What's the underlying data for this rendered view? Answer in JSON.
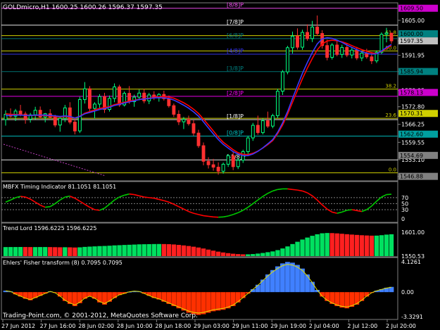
{
  "chart_data": [
    {
      "type": "candlestick",
      "title": "GOLDmicro,H1  1600.25 1600.26 1596.37 1597.35",
      "y_ticks": [
        "1605.00",
        "1597.35",
        "1591.95",
        "1585.90",
        "1578.85",
        "1572.80",
        "1566.25",
        "1559.55",
        "1553.10",
        "1546.85"
      ],
      "fib_levels": [
        {
          "label": "61.8",
          "value": 1599.3
        },
        {
          "label": "50.0",
          "value": 1593.6
        },
        {
          "label": "38.2",
          "value": 1579.4
        },
        {
          "label": "23.6",
          "value": 1568.5
        },
        {
          "label": "0.0",
          "value": 1548.2
        }
      ],
      "murrey_levels": [
        {
          "label": "[8/8]P",
          "value": 1609.5,
          "color": "#ff55ff"
        },
        {
          "label": "[7/8]P",
          "value": 1603.2,
          "color": "#ffffff"
        },
        {
          "label": "[6/8]P",
          "value": 1598.2,
          "color": "#008080"
        },
        {
          "label": "[4/8]P",
          "value": 1592.4,
          "color": "#3a3aff"
        },
        {
          "label": "[3/8]P",
          "value": 1585.9,
          "color": "#008080"
        },
        {
          "label": "[2/8]P",
          "value": 1576.7,
          "color": "#ff00ff"
        },
        {
          "label": "[1/8]P",
          "value": 1568.0,
          "color": "#ffffff"
        },
        {
          "label": "[0/8]P",
          "value": 1561.9,
          "color": "#00cccc"
        },
        {
          "label": "[-1/8]P",
          "value": 1553.0,
          "color": "#ffffff"
        }
      ],
      "price_tags": [
        {
          "label": "1609.50",
          "value": 1609.5,
          "color": "#cc00cc"
        },
        {
          "label": "1600.00",
          "value": 1600.0,
          "color": "#008080"
        },
        {
          "label": "1597.35",
          "value": 1597.35,
          "color": "#c0c0c0"
        },
        {
          "label": "1585.94",
          "value": 1585.94,
          "color": "#008080"
        },
        {
          "label": "1578.13",
          "value": 1578.13,
          "color": "#cc00cc"
        },
        {
          "label": "1570.31",
          "value": 1570.31,
          "color": "#d0d000"
        },
        {
          "label": "1562.60",
          "value": 1562.6,
          "color": "#00a0a0"
        },
        {
          "label": "1554.69",
          "value": 1554.69,
          "color": "#808080"
        },
        {
          "label": "1546.88",
          "value": 1546.88,
          "color": "#808080"
        }
      ],
      "ylim": [
        1546,
        1611
      ],
      "candles": [
        [
          1568.0,
          1571.5,
          1565.8,
          1570.0
        ],
        [
          1570.0,
          1572.2,
          1568.8,
          1569.3
        ],
        [
          1569.3,
          1572.0,
          1567.5,
          1571.2
        ],
        [
          1571.2,
          1573.5,
          1569.2,
          1570.1
        ],
        [
          1570.1,
          1571.0,
          1566.5,
          1568.2
        ],
        [
          1568.2,
          1570.5,
          1566.9,
          1569.8
        ],
        [
          1569.8,
          1572.8,
          1568.1,
          1571.5
        ],
        [
          1571.5,
          1572.9,
          1568.4,
          1569.0
        ],
        [
          1569.0,
          1570.5,
          1567.0,
          1570.2
        ],
        [
          1570.2,
          1571.9,
          1568.5,
          1568.9
        ],
        [
          1568.9,
          1569.8,
          1565.2,
          1566.0
        ],
        [
          1566.0,
          1569.4,
          1563.5,
          1568.5
        ],
        [
          1568.5,
          1573.5,
          1567.1,
          1572.4
        ],
        [
          1572.4,
          1574.5,
          1566.3,
          1567.1
        ],
        [
          1567.1,
          1568.5,
          1562.5,
          1563.8
        ],
        [
          1563.8,
          1576.5,
          1563.0,
          1575.5
        ],
        [
          1575.5,
          1582.0,
          1574.0,
          1579.5
        ],
        [
          1579.5,
          1580.5,
          1571.0,
          1572.2
        ],
        [
          1572.2,
          1574.5,
          1568.4,
          1573.8
        ],
        [
          1573.8,
          1577.5,
          1572.0,
          1576.6
        ],
        [
          1576.6,
          1578.0,
          1570.5,
          1571.8
        ],
        [
          1571.8,
          1577.0,
          1571.0,
          1575.9
        ],
        [
          1575.9,
          1581.5,
          1574.5,
          1580.2
        ],
        [
          1580.2,
          1581.0,
          1572.8,
          1573.5
        ],
        [
          1573.5,
          1578.5,
          1572.9,
          1577.8
        ],
        [
          1577.8,
          1580.5,
          1573.9,
          1574.7
        ],
        [
          1574.7,
          1577.3,
          1572.8,
          1576.4
        ],
        [
          1576.4,
          1579.2,
          1575.2,
          1577.9
        ],
        [
          1577.9,
          1579.5,
          1574.1,
          1575.0
        ],
        [
          1575.0,
          1578.0,
          1573.8,
          1577.2
        ],
        [
          1577.2,
          1578.6,
          1575.3,
          1576.1
        ],
        [
          1576.1,
          1577.9,
          1574.7,
          1577.4
        ],
        [
          1577.4,
          1578.8,
          1575.1,
          1575.8
        ],
        [
          1575.8,
          1577.0,
          1572.5,
          1573.2
        ],
        [
          1573.2,
          1574.0,
          1569.0,
          1570.0
        ],
        [
          1570.0,
          1571.5,
          1566.0,
          1567.2
        ],
        [
          1567.2,
          1569.0,
          1564.5,
          1568.1
        ],
        [
          1568.1,
          1569.5,
          1565.8,
          1566.5
        ],
        [
          1566.5,
          1567.8,
          1562.0,
          1563.0
        ],
        [
          1563.0,
          1564.2,
          1557.5,
          1558.3
        ],
        [
          1558.3,
          1559.5,
          1551.0,
          1552.5
        ],
        [
          1552.5,
          1554.0,
          1549.8,
          1551.2
        ],
        [
          1551.2,
          1553.4,
          1549.0,
          1550.3
        ],
        [
          1550.3,
          1552.1,
          1547.5,
          1548.8
        ],
        [
          1548.8,
          1552.0,
          1547.9,
          1551.4
        ],
        [
          1551.4,
          1555.2,
          1550.4,
          1554.6
        ],
        [
          1554.6,
          1556.0,
          1549.2,
          1550.5
        ],
        [
          1550.5,
          1553.8,
          1549.6,
          1552.9
        ],
        [
          1552.9,
          1556.8,
          1551.9,
          1556.1
        ],
        [
          1556.1,
          1562.0,
          1555.0,
          1561.2
        ],
        [
          1561.2,
          1566.8,
          1560.1,
          1565.9
        ],
        [
          1565.9,
          1569.5,
          1562.4,
          1563.2
        ],
        [
          1563.2,
          1568.4,
          1562.5,
          1567.6
        ],
        [
          1567.6,
          1571.0,
          1564.9,
          1565.6
        ],
        [
          1565.6,
          1570.2,
          1564.8,
          1569.5
        ],
        [
          1569.5,
          1579.5,
          1568.6,
          1578.6
        ],
        [
          1578.6,
          1586.5,
          1577.2,
          1585.8
        ],
        [
          1585.8,
          1595.5,
          1584.9,
          1594.8
        ],
        [
          1594.8,
          1600.8,
          1592.6,
          1599.1
        ],
        [
          1599.1,
          1602.0,
          1594.1,
          1595.0
        ],
        [
          1595.0,
          1601.5,
          1594.0,
          1600.5
        ],
        [
          1600.5,
          1603.5,
          1597.4,
          1598.2
        ],
        [
          1598.2,
          1604.8,
          1596.9,
          1602.5
        ],
        [
          1602.5,
          1606.8,
          1599.2,
          1600.1
        ],
        [
          1600.1,
          1601.3,
          1594.5,
          1595.6
        ],
        [
          1595.6,
          1597.8,
          1590.1,
          1591.2
        ],
        [
          1591.2,
          1596.5,
          1590.4,
          1595.8
        ],
        [
          1595.8,
          1597.2,
          1591.6,
          1592.3
        ],
        [
          1592.3,
          1595.9,
          1591.0,
          1594.9
        ],
        [
          1594.9,
          1596.3,
          1591.3,
          1592.1
        ],
        [
          1592.1,
          1594.8,
          1590.8,
          1593.9
        ],
        [
          1593.9,
          1595.1,
          1590.2,
          1591.0
        ],
        [
          1591.0,
          1593.6,
          1589.8,
          1592.8
        ],
        [
          1592.8,
          1594.4,
          1590.7,
          1591.4
        ],
        [
          1591.4,
          1593.2,
          1588.7,
          1589.9
        ],
        [
          1589.9,
          1593.8,
          1589.1,
          1593.1
        ],
        [
          1593.1,
          1600.5,
          1592.4,
          1599.8
        ],
        [
          1599.8,
          1602.2,
          1596.8,
          1600.25
        ],
        [
          1600.25,
          1600.26,
          1596.37,
          1597.35
        ]
      ],
      "ma_red": [
        1570.2,
        1570.0,
        1569.9,
        1569.8,
        1569.7,
        1569.6,
        1569.6,
        1569.6,
        1569.5,
        1569.4,
        1569.2,
        1569.0,
        1569.2,
        1569.0,
        1568.6,
        1569.3,
        1570.4,
        1571.0,
        1571.6,
        1572.2,
        1572.5,
        1572.9,
        1573.6,
        1574.0,
        1574.5,
        1574.9,
        1575.2,
        1575.6,
        1575.8,
        1576.0,
        1576.3,
        1576.5,
        1576.5,
        1576.4,
        1576.0,
        1575.2,
        1574.3,
        1573.2,
        1571.9,
        1570.3,
        1568.2,
        1566.0,
        1563.8,
        1561.5,
        1559.6,
        1558.2,
        1556.8,
        1555.7,
        1555.1,
        1555.0,
        1555.5,
        1556.3,
        1557.4,
        1558.7,
        1560.2,
        1562.8,
        1566.0,
        1570.0,
        1574.5,
        1578.9,
        1583.2,
        1587.2,
        1590.8,
        1594.0,
        1596.2,
        1597.3,
        1597.6,
        1597.4,
        1597.0,
        1596.4,
        1595.6,
        1594.8,
        1594.1,
        1593.5,
        1592.9,
        1592.6,
        1593.4,
        1594.6,
        1595.6
      ],
      "ma_blue": [
        1569.5,
        1569.6,
        1569.7,
        1569.7,
        1569.6,
        1569.6,
        1569.7,
        1569.7,
        1569.7,
        1569.6,
        1569.4,
        1569.2,
        1569.4,
        1569.2,
        1568.6,
        1569.2,
        1570.2,
        1570.7,
        1571.2,
        1571.8,
        1572.1,
        1572.6,
        1573.3,
        1573.7,
        1574.2,
        1574.6,
        1575.0,
        1575.5,
        1575.7,
        1575.9,
        1576.1,
        1576.2,
        1576.1,
        1575.9,
        1575.3,
        1574.4,
        1573.4,
        1572.3,
        1570.9,
        1569.3,
        1567.2,
        1564.9,
        1562.7,
        1560.6,
        1558.8,
        1557.4,
        1556.1,
        1555.2,
        1554.6,
        1554.6,
        1555.2,
        1556.2,
        1557.5,
        1559.0,
        1560.6,
        1563.3,
        1566.8,
        1571.0,
        1575.9,
        1580.6,
        1585.2,
        1589.3,
        1593.0,
        1596.2,
        1598.1,
        1598.5,
        1598.3,
        1597.6,
        1596.8,
        1595.8,
        1594.9,
        1594.1,
        1593.3,
        1592.8,
        1592.4,
        1592.5,
        1593.6,
        1594.9,
        1596.0
      ]
    },
    {
      "type": "line",
      "title": "MBFX Timing Indicator 81.1051 81.1051",
      "y_ticks": [
        "70",
        "50",
        "30",
        "0"
      ],
      "ylim": [
        -5,
        100
      ],
      "values": [
        55,
        62,
        70,
        74,
        72,
        65,
        55,
        45,
        38,
        40,
        50,
        62,
        72,
        75,
        68,
        58,
        48,
        38,
        30,
        28,
        35,
        48,
        62,
        72,
        78,
        82,
        80,
        76,
        72,
        70,
        68,
        64,
        60,
        55,
        48,
        40,
        32,
        24,
        18,
        14,
        10,
        8,
        6,
        5,
        6,
        9,
        14,
        20,
        28,
        38,
        50,
        62,
        74,
        84,
        92,
        97,
        99,
        99,
        97,
        95,
        92,
        86,
        76,
        62,
        46,
        32,
        22,
        18,
        22,
        28,
        30,
        27,
        24,
        30,
        42,
        58,
        72,
        80,
        81.1051
      ]
    },
    {
      "type": "bar",
      "title": "Trend Lord 1596.6225 1596.6225",
      "y_ticks": [
        "1601.00",
        "1550.53"
      ],
      "ylim": [
        1550.53,
        1601.0
      ],
      "values": [
        1569.6,
        1569.7,
        1569.7,
        1569.8,
        1569.7,
        1569.6,
        1569.6,
        1569.7,
        1569.7,
        1569.6,
        1569.4,
        1569.2,
        1569.3,
        1569.1,
        1568.7,
        1569.1,
        1570.0,
        1570.6,
        1571.1,
        1571.7,
        1572.0,
        1572.5,
        1573.2,
        1573.6,
        1574.1,
        1574.5,
        1574.9,
        1575.4,
        1575.6,
        1575.8,
        1576.0,
        1576.1,
        1576.0,
        1575.7,
        1575.1,
        1574.2,
        1573.1,
        1571.9,
        1570.4,
        1568.7,
        1566.6,
        1564.3,
        1562.1,
        1560.0,
        1558.2,
        1556.8,
        1555.6,
        1554.8,
        1554.3,
        1554.3,
        1554.9,
        1555.9,
        1557.2,
        1558.8,
        1560.5,
        1563.2,
        1566.7,
        1571.0,
        1576.0,
        1580.8,
        1585.5,
        1589.7,
        1593.4,
        1596.6,
        1598.7,
        1599.3,
        1599.1,
        1598.5,
        1597.7,
        1596.8,
        1596.0,
        1595.3,
        1594.6,
        1594.1,
        1593.7,
        1593.8,
        1594.7,
        1595.9,
        1596.6225
      ],
      "colors": "green=rising, red=falling"
    },
    {
      "type": "bar",
      "title": "Ehlers' Fisher transform (8) 0.7095 0.7095",
      "y_ticks": [
        "4.1261",
        "0.00",
        "-3.3291"
      ],
      "ylim": [
        -3.3291,
        4.1261
      ],
      "values": [
        0.2,
        0.1,
        -0.3,
        -0.6,
        -0.9,
        -1.1,
        -0.8,
        -0.5,
        -0.2,
        0.1,
        -0.1,
        -0.6,
        -1.2,
        -1.6,
        -1.9,
        -1.5,
        -0.9,
        -0.6,
        -0.9,
        -1.4,
        -1.7,
        -1.3,
        -0.8,
        -0.4,
        -0.2,
        0.05,
        0.15,
        0.1,
        -0.2,
        -0.5,
        -0.8,
        -1.0,
        -1.3,
        -1.6,
        -1.9,
        -2.2,
        -2.5,
        -2.8,
        -3.0,
        -3.1,
        -3.0,
        -2.8,
        -2.6,
        -2.5,
        -2.4,
        -2.2,
        -1.9,
        -1.4,
        -0.8,
        -0.2,
        0.4,
        1.0,
        1.7,
        2.4,
        3.0,
        3.5,
        3.9,
        4.1,
        4.0,
        3.7,
        3.2,
        2.4,
        1.4,
        0.3,
        -0.6,
        -1.2,
        -1.6,
        -1.9,
        -2.1,
        -2.2,
        -2.0,
        -1.7,
        -1.2,
        -0.6,
        -0.1,
        0.2,
        0.4,
        0.6,
        0.7095
      ]
    }
  ],
  "x_ticks": [
    "27 Jun 2012",
    "27 Jun 16:00",
    "28 Jun 02:00",
    "28 Jun 10:00",
    "28 Jun 18:00",
    "29 Jun 03:00",
    "29 Jun 11:00",
    "29 Jun 19:00",
    "2 Jul 04:00",
    "2 Jul 12:00",
    "2 Jul 20:00"
  ],
  "copyright": "Trading-Point.com, © 2001-2012, MetaQuotes Software Corp.",
  "colors": {
    "bull": "#00ff7f",
    "bear": "#ff3030",
    "fib": "#d0d000",
    "ma_red": "#ff0000",
    "ma_blue": "#3a3aff",
    "tl_up": "#00e060",
    "tl_down": "#ff2020",
    "fisher_pos": "#4080ff",
    "fisher_neg": "#ff3000",
    "grid": "#808080",
    "text": "#ffffff"
  }
}
